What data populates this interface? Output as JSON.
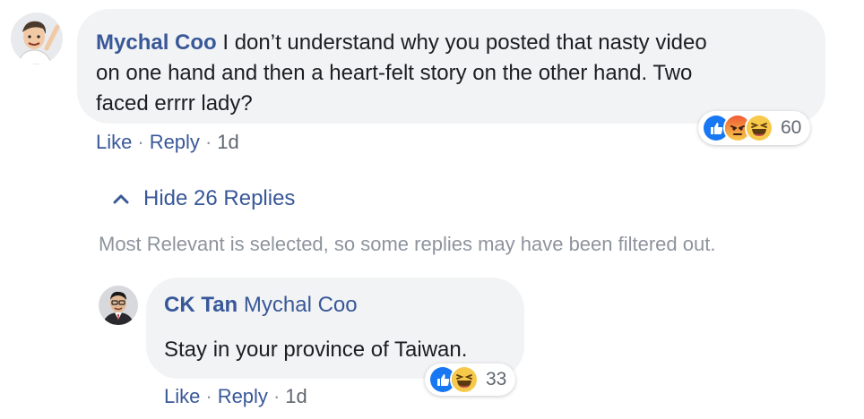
{
  "comment": {
    "author": "Mychal Coo",
    "text_line1": " I don’t understand why you posted that nasty video",
    "text_line2": "on one hand and then a heart-felt story on the other hand. Two",
    "text_line3": "faced errrr lady?",
    "reactions": [
      "like-icon",
      "angry-icon",
      "haha-icon"
    ],
    "reaction_count": "60",
    "actions": {
      "like": "Like",
      "reply": "Reply",
      "time": "1d",
      "separator": "·"
    }
  },
  "replies_toggle": {
    "icon": "chevron-up-icon",
    "label": "Hide 26 Replies"
  },
  "filter_note": "Most Relevant is selected, so some replies may have been filtered out.",
  "reply": {
    "author": "CK Tan",
    "mention": "Mychal Coo",
    "text": "Stay in your province of Taiwan.",
    "reactions": [
      "like-icon",
      "haha-icon"
    ],
    "reaction_count": "33",
    "actions": {
      "like": "Like",
      "reply": "Reply",
      "time": "1d",
      "separator": "·"
    }
  },
  "colors": {
    "link_blue": "#385898",
    "bubble_bg": "#f2f3f5",
    "meta_gray": "#606770",
    "note_gray": "#8d949e",
    "like_blue": "#1877f2",
    "angry_orange": "#f15b35",
    "haha_yellow": "#f7c94b"
  }
}
